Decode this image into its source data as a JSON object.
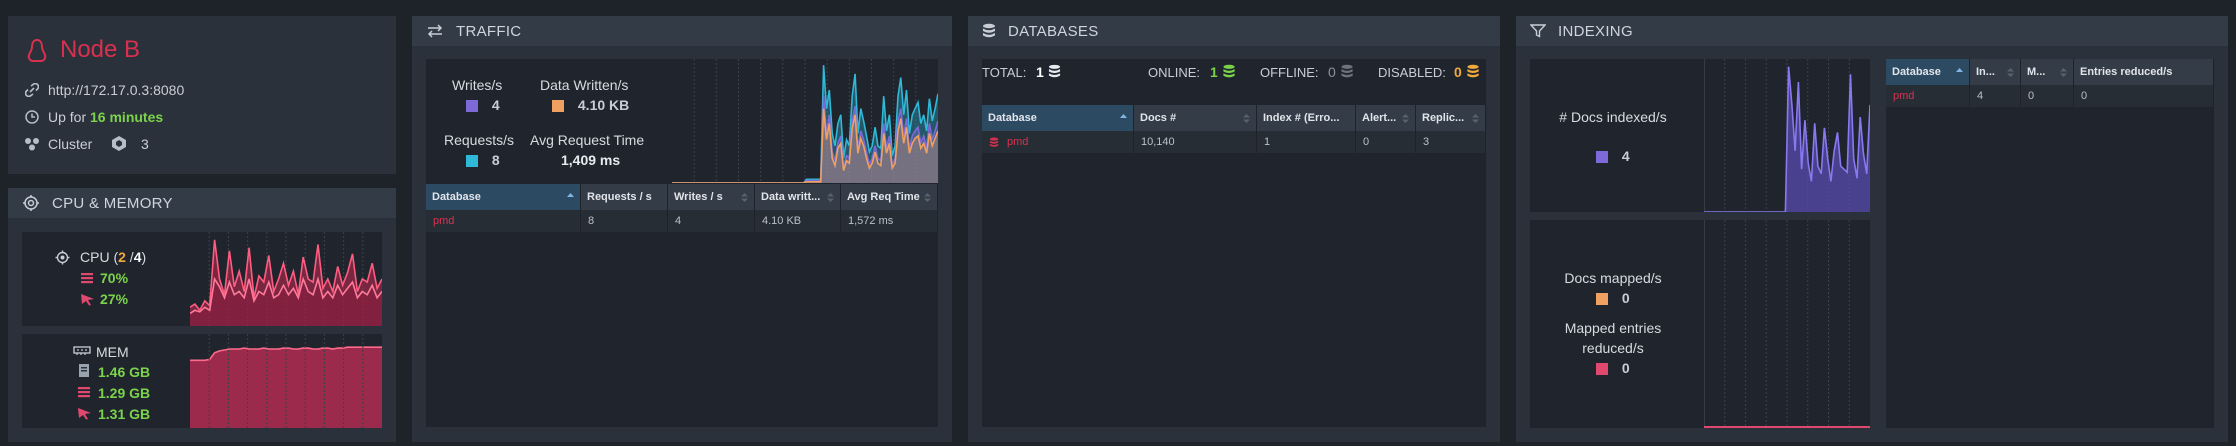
{
  "node": {
    "name": "Node B",
    "url": "http://172.17.0.3:8080",
    "uptime_prefix": "Up for",
    "uptime_value": "16 minutes",
    "cluster_label": "Cluster",
    "cluster_count": "3"
  },
  "cpu_memory": {
    "title": "CPU & MEMORY",
    "cpu_label": "CPU (",
    "cpu_used": "2",
    "cpu_sep": " /",
    "cpu_total": "4",
    "cpu_close": ")",
    "cpu_machine": "70%",
    "cpu_process": "27%",
    "mem_label": "MEM",
    "mem_1": "1.46 GB",
    "mem_2": "1.29 GB",
    "mem_3": "1.31 GB",
    "cpu_series": [
      12,
      14,
      10,
      16,
      13,
      55,
      30,
      20,
      48,
      25,
      35,
      22,
      50,
      18,
      32,
      28,
      45,
      22,
      30,
      40,
      26,
      35,
      20,
      44,
      30,
      28,
      52,
      24,
      30,
      22,
      38,
      26,
      34,
      46,
      22,
      30,
      28,
      40,
      24,
      30
    ],
    "cpu_series2": [
      8,
      10,
      9,
      12,
      10,
      30,
      25,
      18,
      28,
      20,
      22,
      18,
      30,
      16,
      22,
      20,
      28,
      18,
      20,
      26,
      20,
      24,
      18,
      30,
      22,
      20,
      30,
      18,
      22,
      18,
      26,
      20,
      24,
      28,
      18,
      22,
      20,
      26,
      18,
      22
    ],
    "mem_series": [
      72,
      72,
      72,
      72,
      73,
      80,
      82,
      83,
      84,
      84,
      84,
      85,
      84,
      84,
      84,
      85,
      84,
      84,
      84,
      85,
      85,
      84,
      84,
      85,
      85,
      84,
      84,
      85,
      85,
      84,
      85,
      85,
      86,
      86,
      86,
      86,
      86,
      86,
      86,
      86
    ]
  },
  "traffic": {
    "title": "TRAFFIC",
    "writes_label": "Writes/s",
    "writes_value": "4",
    "data_written_label": "Data Written/s",
    "data_written_value": "4.10 KB",
    "requests_label": "Requests/s",
    "requests_value": "8",
    "avg_req_label": "Avg Request Time",
    "avg_req_value": "1,409 ms",
    "columns": [
      "Database",
      "Requests / s",
      "Writes / s",
      "Data writt...",
      "Avg Req Time"
    ],
    "rows": [
      {
        "database": "pmd",
        "requests": "8",
        "writes": "4",
        "data": "4.10 KB",
        "avg": "1,572 ms"
      }
    ],
    "series_requests": [
      0,
      0,
      0,
      0,
      0,
      0,
      0,
      0,
      0,
      0,
      0,
      0,
      0,
      0,
      0,
      0,
      0,
      0,
      0,
      0,
      0,
      0,
      0,
      0,
      0,
      0,
      0,
      0,
      0,
      0,
      0,
      0,
      0,
      0,
      0,
      0,
      0,
      0,
      0,
      0,
      0,
      0,
      0,
      0,
      0,
      0,
      0,
      3,
      3,
      3,
      3,
      3,
      3,
      95,
      60,
      75,
      40,
      30,
      48,
      55,
      20,
      35,
      30,
      70,
      88,
      40,
      60,
      50,
      38,
      25,
      30,
      45,
      30,
      28,
      70,
      42,
      55,
      22,
      30,
      70,
      85,
      55,
      75,
      40,
      55,
      60,
      65,
      48,
      55,
      42,
      68,
      50,
      60,
      72
    ],
    "series_writes": [
      0,
      0,
      0,
      0,
      0,
      0,
      0,
      0,
      0,
      0,
      0,
      0,
      0,
      0,
      0,
      0,
      0,
      0,
      0,
      0,
      0,
      0,
      0,
      0,
      0,
      0,
      0,
      0,
      0,
      0,
      0,
      0,
      0,
      0,
      0,
      0,
      0,
      0,
      0,
      0,
      0,
      0,
      0,
      0,
      0,
      0,
      0,
      2,
      2,
      2,
      2,
      2,
      2,
      70,
      40,
      55,
      25,
      18,
      32,
      38,
      12,
      22,
      20,
      50,
      62,
      28,
      42,
      35,
      25,
      15,
      20,
      30,
      20,
      18,
      48,
      28,
      38,
      14,
      20,
      50,
      60,
      38,
      52,
      28,
      38,
      42,
      45,
      32,
      38,
      28,
      48,
      35,
      42,
      50
    ],
    "series_data": [
      0,
      0,
      0,
      0,
      0,
      0,
      0,
      0,
      0,
      0,
      0,
      0,
      0,
      0,
      0,
      0,
      0,
      0,
      0,
      0,
      0,
      0,
      0,
      0,
      0,
      0,
      0,
      0,
      0,
      0,
      0,
      0,
      0,
      0,
      0,
      0,
      0,
      0,
      0,
      0,
      0,
      0,
      0,
      0,
      0,
      0,
      0,
      1,
      1,
      1,
      1,
      1,
      1,
      60,
      35,
      48,
      20,
      14,
      28,
      32,
      10,
      18,
      16,
      44,
      55,
      24,
      36,
      30,
      20,
      12,
      16,
      25,
      16,
      14,
      40,
      24,
      32,
      12,
      16,
      42,
      52,
      32,
      45,
      24,
      32,
      36,
      38,
      28,
      32,
      24,
      40,
      30,
      36,
      42
    ]
  },
  "databases": {
    "title": "DATABASES",
    "total_label": "TOTAL:",
    "total_value": "1",
    "online_label": "ONLINE:",
    "online_value": "1",
    "offline_label": "OFFLINE:",
    "offline_value": "0",
    "disabled_label": "DISABLED:",
    "disabled_value": "0",
    "columns": [
      "Database",
      "Docs #",
      "Index # (Erro...",
      "Alert...",
      "Replic..."
    ],
    "rows": [
      {
        "database": "pmd",
        "docs": "10,140",
        "index": "1",
        "alerts": "0",
        "replication": "3"
      }
    ]
  },
  "indexing": {
    "title": "INDEXING",
    "docs_indexed_label": "# Docs indexed/s",
    "docs_indexed_value": "4",
    "docs_mapped_label": "Docs mapped/s",
    "docs_mapped_value": "0",
    "mapped_entries_label": "Mapped entries reduced/s",
    "mapped_entries_value": "0",
    "columns": [
      "Database",
      "In...",
      "M...",
      "Entries reduced/s"
    ],
    "rows": [
      {
        "database": "pmd",
        "in": "4",
        "m": "0",
        "entries": "0"
      }
    ],
    "series_indexed": [
      0,
      0,
      0,
      0,
      0,
      0,
      0,
      0,
      0,
      0,
      0,
      0,
      0,
      0,
      0,
      0,
      0,
      0,
      0,
      0,
      0,
      0,
      0,
      0,
      0,
      0,
      95,
      70,
      40,
      85,
      28,
      60,
      32,
      20,
      58,
      30,
      25,
      55,
      35,
      20,
      40,
      52,
      30,
      28,
      26,
      90,
      35,
      22,
      62,
      38,
      25,
      70
    ]
  },
  "colors": {
    "accent_red": "#d9304f",
    "green": "#7bd34a",
    "orange": "#f0a93c",
    "purple": "#7d6ad8",
    "cyan": "#2fb8d8",
    "pink": "#e0486e"
  }
}
